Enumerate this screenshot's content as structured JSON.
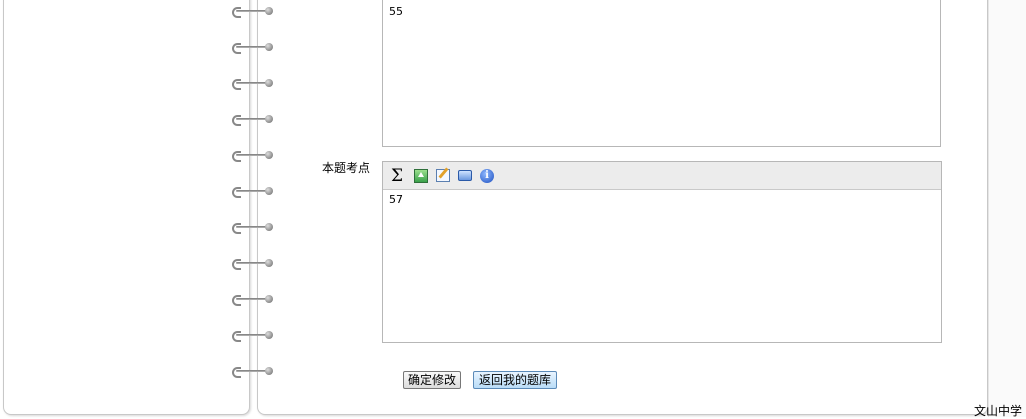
{
  "editors": {
    "answer": {
      "content": "55"
    },
    "knowledge_point": {
      "label": "本题考点",
      "content": "57",
      "toolbar": [
        {
          "name": "sigma-icon",
          "glyph": "Σ"
        },
        {
          "name": "upload-image-icon"
        },
        {
          "name": "edit-icon"
        },
        {
          "name": "screen-icon"
        },
        {
          "name": "info-icon",
          "glyph": "i"
        }
      ]
    }
  },
  "buttons": {
    "confirm_label": "确定修改",
    "back_label": "返回我的题库"
  },
  "footer": {
    "school_name": "文山中学"
  },
  "notebook": {
    "ring_count": 11
  }
}
